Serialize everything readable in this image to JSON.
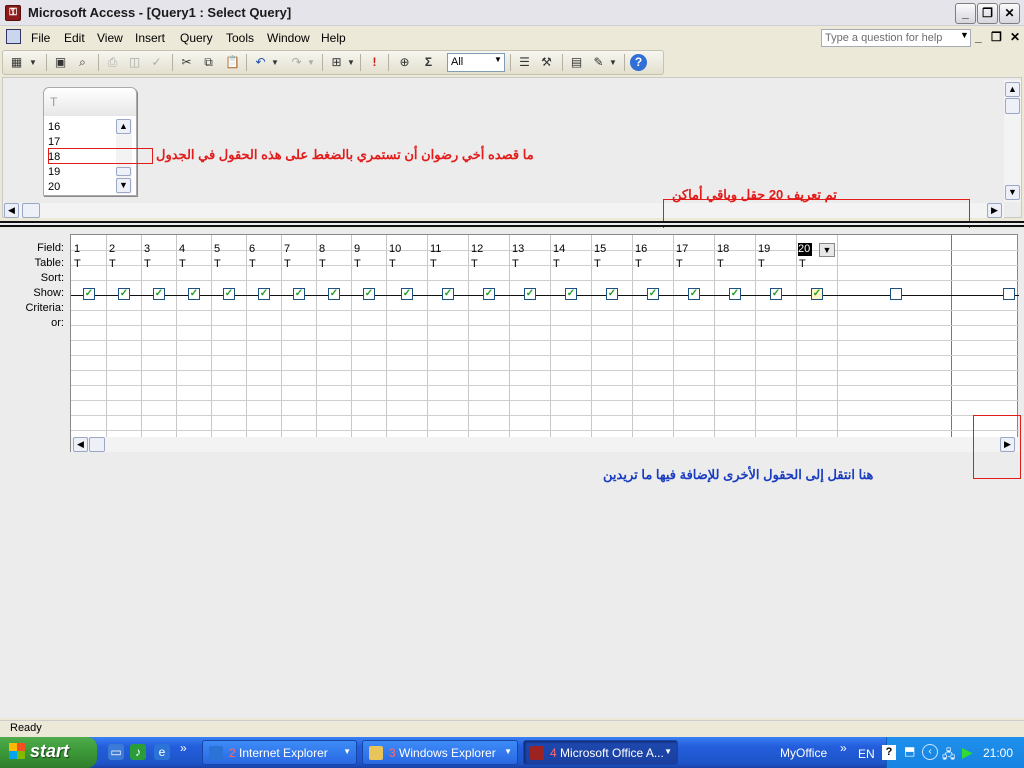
{
  "window": {
    "title": "Microsoft Access - [Query1 : Select Query]",
    "help_placeholder": "Type a question for help"
  },
  "menu": [
    "File",
    "Edit",
    "View",
    "Insert",
    "Query",
    "Tools",
    "Window",
    "Help"
  ],
  "toolbar": {
    "query_type_value": "All",
    "totals_symbol": "Σ",
    "run_symbol": "!"
  },
  "table_box": {
    "title": "T",
    "fields": [
      "16",
      "17",
      "18",
      "19",
      "20"
    ]
  },
  "grid": {
    "row_labels": [
      "Field:",
      "Table:",
      "Sort:",
      "Show:",
      "Criteria:",
      "or:"
    ],
    "fields": [
      "1",
      "2",
      "3",
      "4",
      "5",
      "6",
      "7",
      "8",
      "9",
      "10",
      "11",
      "12",
      "13",
      "14",
      "15",
      "16",
      "17",
      "18",
      "19",
      "20"
    ],
    "table_value": "T"
  },
  "annotations": {
    "note_fields": "ما قصده أخي رضوان أن تستمري بالضغط على هذه الحقول في الجدول",
    "note_twenty": "تم تعريف 20 حقل وباقي أماكن",
    "note_scroll": "هنا انتقل إلى الحقول الأخرى للإضافة فيها ما تريدين"
  },
  "status": {
    "text": "Ready"
  },
  "taskbar": {
    "start_label": "start",
    "tasks": [
      {
        "count": "2",
        "label": "Internet Explorer"
      },
      {
        "count": "3",
        "label": "Windows Explorer"
      },
      {
        "count": "4",
        "label": "Microsoft Office A..."
      }
    ],
    "myoffice": "MyOffice",
    "language": "EN",
    "clock": "21:00"
  }
}
